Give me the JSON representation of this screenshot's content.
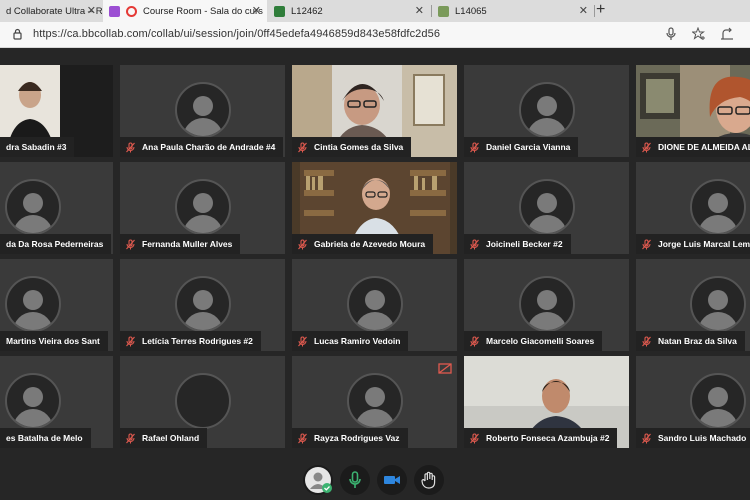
{
  "browser": {
    "tabs": [
      {
        "title": "d Collaborate Ultra – R",
        "favicon_color": "#7b5fc6",
        "active": false
      },
      {
        "title": "Course Room - Sala do curs",
        "favicon_color": "#9c4fd3",
        "active": true
      },
      {
        "title": "L12462",
        "favicon_color": "#3a7d3a",
        "active": false
      },
      {
        "title": "L14065",
        "favicon_color": "#7a9a5a",
        "active": false
      }
    ],
    "url": "https://ca.bbcollab.com/collab/ui/session/join/0ff45edefa4946859d843e58fdfc2d56"
  },
  "participants": [
    {
      "name": "dra Sabadin #3",
      "video": true
    },
    {
      "name": "Ana Paula Charão de Andrade #4",
      "video": false
    },
    {
      "name": "Cintia Gomes da Silva",
      "video": true
    },
    {
      "name": "Daniel Garcia Vianna",
      "video": false
    },
    {
      "name": "DIONE DE ALMEIDA ALV",
      "video": true
    },
    {
      "name": "da Da Rosa Pederneiras",
      "video": false
    },
    {
      "name": "Fernanda Muller Alves",
      "video": false
    },
    {
      "name": "Gabriela de Azevedo Moura",
      "video": true
    },
    {
      "name": "Joicineli Becker #2",
      "video": false
    },
    {
      "name": "Jorge Luis Marcal Lemo",
      "video": false
    },
    {
      "name": "Martins Vieira dos Sant",
      "video": false
    },
    {
      "name": "Letícia Terres Rodrigues #2",
      "video": false
    },
    {
      "name": "Lucas Ramiro Vedoin",
      "video": false
    },
    {
      "name": "Marcelo Giacomelli Soares",
      "video": false
    },
    {
      "name": "Natan Braz da Silva",
      "video": false
    },
    {
      "name": "es Batalha de Melo",
      "video": false
    },
    {
      "name": "Rafael Ohland",
      "video": false
    },
    {
      "name": "Rayza Rodrigues Vaz",
      "video": false
    },
    {
      "name": "Roberto Fonseca Azambuja #2",
      "video": true
    },
    {
      "name": "Sandro Luis Machado",
      "video": false
    }
  ],
  "controls": {
    "items": [
      "status-profile",
      "microphone",
      "camera",
      "raise-hand"
    ]
  },
  "colors": {
    "accent_mic": "#3cb371",
    "accent_cam": "#2e86de",
    "muted_red": "#e05a4f"
  }
}
